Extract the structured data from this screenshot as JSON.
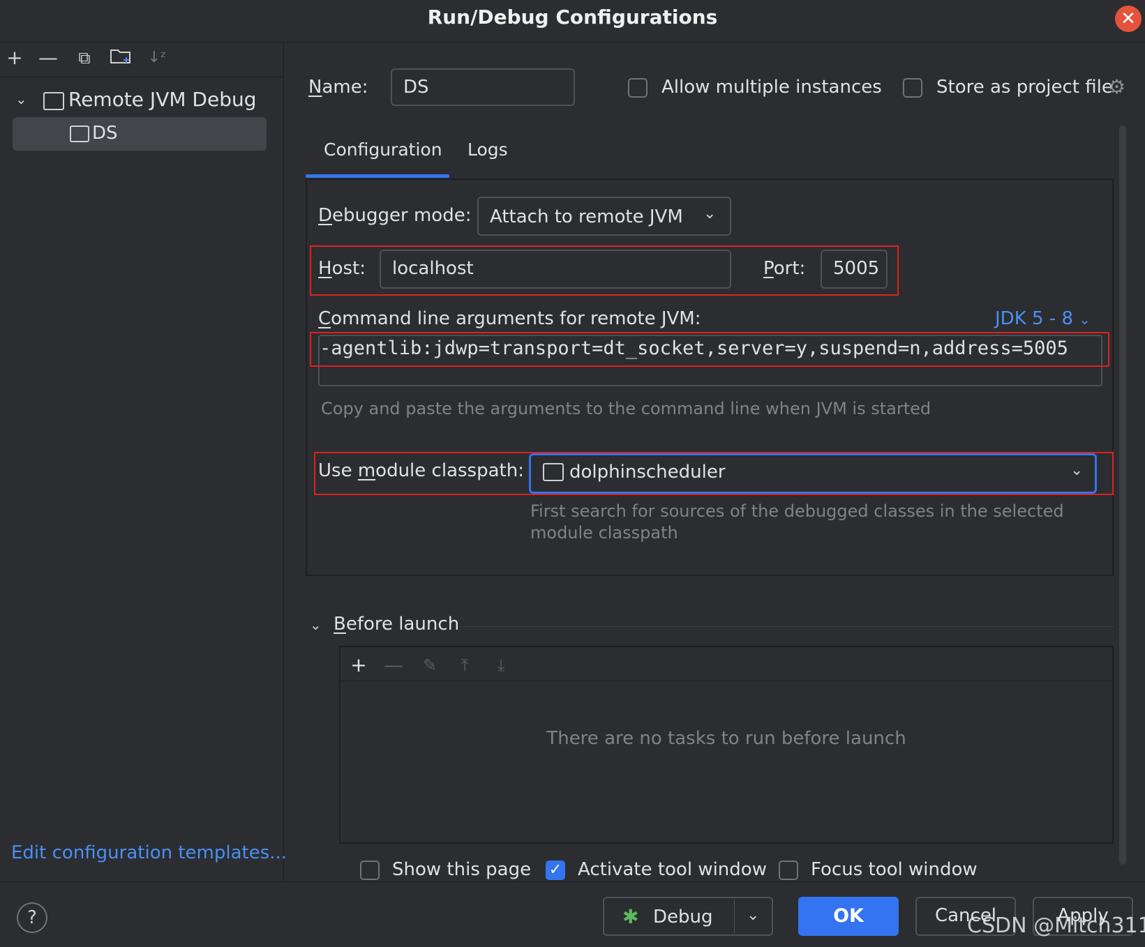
{
  "window": {
    "title": "Run/Debug Configurations",
    "close_icon": "close-icon"
  },
  "sidebar": {
    "toolbar": [
      "add-icon",
      "remove-icon",
      "copy-icon",
      "new-folder-icon",
      "sort-icon"
    ],
    "tree": {
      "group_label": "Remote JVM Debug",
      "item_label": "DS"
    },
    "edit_templates": "Edit configuration templates..."
  },
  "header": {
    "name_label_u": "N",
    "name_label_rest": "ame:",
    "name_value": "DS",
    "allow_multiple": "Allow multiple instances",
    "store_project": "Store as project file"
  },
  "tabs": [
    {
      "label": "Configuration",
      "active": true
    },
    {
      "label": "Logs",
      "active": false
    }
  ],
  "config": {
    "debugger_mode_u": "D",
    "debugger_mode_rest": "ebugger mode:",
    "debugger_mode_value": "Attach to remote JVM",
    "host_u": "H",
    "host_rest": "ost:",
    "host_value": "localhost",
    "port_u": "P",
    "port_rest": "ort:",
    "port_value": "5005",
    "cmd_label_u": "C",
    "cmd_label_rest": "ommand line arguments for remote JVM:",
    "jdk_version": "JDK 5 - 8",
    "cmd_value": "-agentlib:jdwp=transport=dt_socket,server=y,suspend=n,address=5005",
    "cmd_hint": "Copy and paste the arguments to the command line when JVM is started",
    "module_label_pre": "Use ",
    "module_label_u": "m",
    "module_label_rest": "odule classpath:",
    "module_value": "dolphinscheduler",
    "module_hint": "First search for sources of the debugged classes in the selected module classpath"
  },
  "before_launch": {
    "label_u": "B",
    "label_rest": "efore launch",
    "empty_text": "There are no tasks to run before launch",
    "show_page": "Show this page",
    "show_page_checked": false,
    "activate_tool": "Activate tool window",
    "activate_tool_checked": true,
    "focus_tool": "Focus tool window",
    "focus_tool_checked": false
  },
  "footer": {
    "help": "?",
    "debug": "Debug",
    "ok": "OK",
    "cancel": "Cancel",
    "apply": "Apply",
    "watermark": "CSDN @Mitch311"
  },
  "colors": {
    "accent": "#3574f0",
    "highlight_box": "#e02020",
    "link": "#4a90f5"
  }
}
